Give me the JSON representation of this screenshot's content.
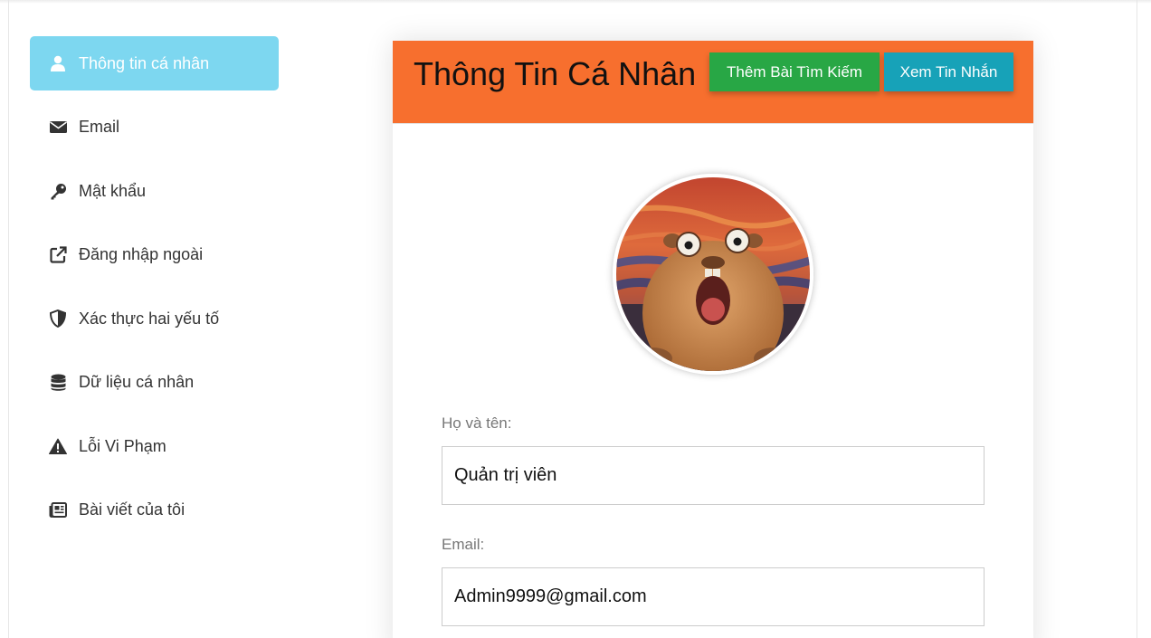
{
  "sidebar": {
    "items": [
      {
        "label": "Thông tin cá nhân",
        "icon": "user-icon",
        "active": true
      },
      {
        "label": "Email",
        "icon": "envelope-icon",
        "active": false
      },
      {
        "label": "Mật khẩu",
        "icon": "key-icon",
        "active": false
      },
      {
        "label": "Đăng nhập ngoài",
        "icon": "external-link-icon",
        "active": false
      },
      {
        "label": "Xác thực hai yếu tố",
        "icon": "shield-icon",
        "active": false
      },
      {
        "label": "Dữ liệu cá nhân",
        "icon": "database-icon",
        "active": false
      },
      {
        "label": "Lỗi Vi Phạm",
        "icon": "warning-icon",
        "active": false
      },
      {
        "label": "Bài viết của tôi",
        "icon": "newspaper-icon",
        "active": false
      }
    ]
  },
  "card": {
    "title": "Thông Tin Cá Nhân",
    "add_search_post_button": "Thêm Bài Tìm Kiếm",
    "view_messages_button": "Xem Tin Nhắn"
  },
  "form": {
    "fullname_label": "Họ và tên:",
    "fullname_value": "Quản trị viên",
    "email_label": "Email:",
    "email_value": "Admin9999@gmail.com"
  },
  "colors": {
    "header_orange": "#f76f2e",
    "active_sidebar": "#7dd7f0",
    "green_button": "#28a745",
    "teal_button": "#17a2b8"
  }
}
